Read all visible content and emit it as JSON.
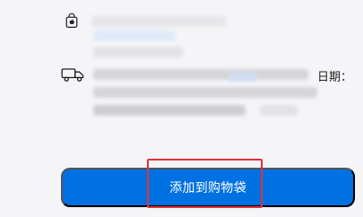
{
  "sections": {
    "pickup": {
      "icon": "apple-store-bag-icon",
      "title_text": ""
    },
    "delivery": {
      "icon": "delivery-truck-icon",
      "date_fragment": "日期："
    }
  },
  "cta": {
    "label": "添加到购物袋",
    "highlight_color": "#e2303a",
    "bg_color": "#0071e3"
  },
  "colors": {
    "page_bg": "#f5f5f7",
    "text": "#1d1d1f",
    "accent": "#0071e3"
  }
}
